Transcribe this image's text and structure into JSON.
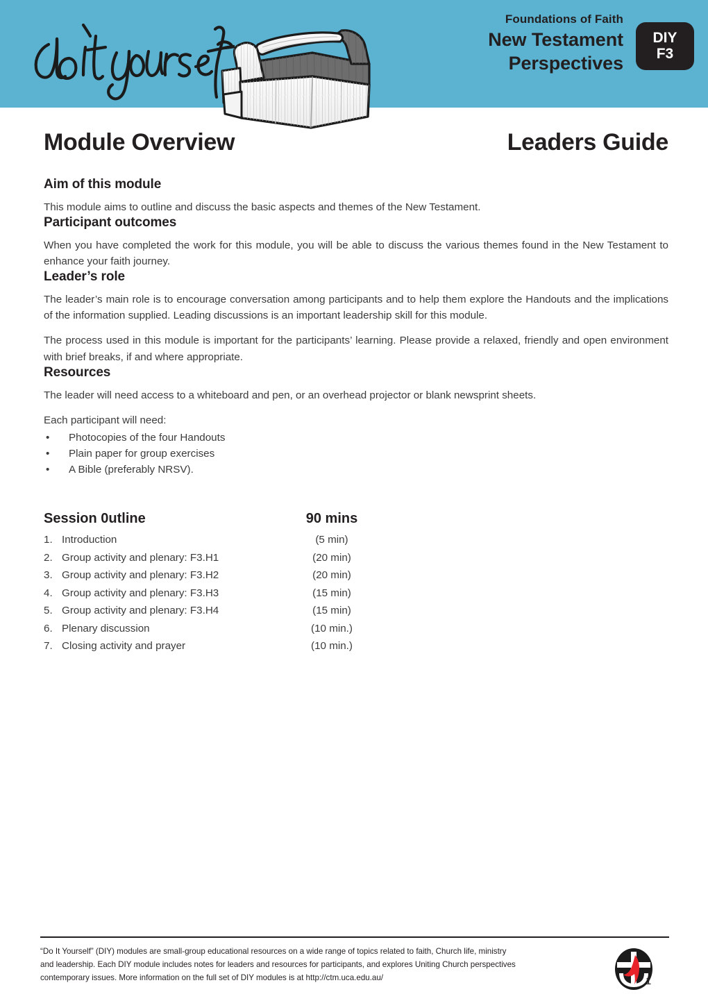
{
  "header": {
    "logo_script_text": "do it yourself",
    "kicker": "Foundations of Faith",
    "title_line1": "New Testament",
    "title_line2": "Perspectives",
    "badge_line1": "DIY",
    "badge_line2": "F3",
    "banner_color": "#5bb3d1",
    "badge_color": "#231f20"
  },
  "titles": {
    "left": "Module Overview",
    "right": "Leaders Guide"
  },
  "sections": {
    "aim": {
      "heading": "Aim of this module",
      "paragraph": "This module aims to outline and discuss the basic aspects and themes of the New Testament."
    },
    "outcomes": {
      "heading": "Participant outcomes",
      "paragraph": "When you have completed the work for this module, you will be able to discuss the various themes found in the New Testament to enhance your faith journey."
    },
    "leader_role": {
      "heading": "Leader’s role",
      "paragraph1": "The leader’s main role is to encourage conversation among participants and to help them explore the Handouts and the implications of the information supplied. Leading discussions is an important leadership skill for this module.",
      "paragraph2": "The process used in this module is important for the participants’ learning. Please provide a relaxed, friendly and open environment with brief breaks, if and where appropriate."
    },
    "resources": {
      "heading": "Resources",
      "paragraph": "The leader will need access to a whiteboard and pen, or an overhead projector or blank newsprint sheets.",
      "list_intro": "Each participant will need:",
      "bullet_char": "•",
      "items": [
        "Photocopies of the four Handouts",
        "Plain paper for group exercises",
        "A Bible (preferably NRSV)."
      ]
    }
  },
  "session_outline": {
    "heading": "Session 0utline",
    "total_duration": "90 mins",
    "rows": [
      {
        "num": "1.",
        "label": "Introduction",
        "duration": "(5 min)"
      },
      {
        "num": "2.",
        "label": "Group activity and plenary: F3.H1",
        "duration": "(20 min)"
      },
      {
        "num": "3.",
        "label": "Group activity and plenary: F3.H2",
        "duration": "(20 min)"
      },
      {
        "num": "4.",
        "label": "Group activity and plenary: F3.H3",
        "duration": "(15 min)"
      },
      {
        "num": "5.",
        "label": "Group activity and plenary: F3.H4",
        "duration": "(15 min)"
      },
      {
        "num": "6.",
        "label": "Plenary discussion",
        "duration": "(10 min.)"
      },
      {
        "num": "7.",
        "label": "Closing activity and prayer",
        "duration": "(10 min.)"
      }
    ]
  },
  "footer": {
    "line1": "“Do It Yourself” (DIY) modules are small-group educational resources on a wide range of topics related to faith, Church life, ministry",
    "line2": "and leadership. Each DIY module includes notes for leaders and resources for participants, and explores Uniting Church perspectives",
    "line3": "contemporary issues. More information on the full set of DIY modules is at http://ctm.uca.edu.au/",
    "page_number": "1",
    "logo_name": "uniting-church-australia-logo",
    "logo_accent_color": "#e8232a"
  }
}
